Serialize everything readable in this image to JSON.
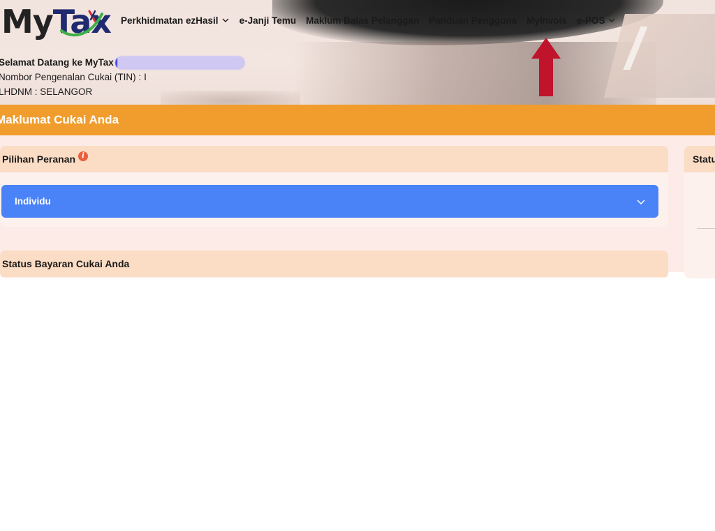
{
  "brand": {
    "logo_prefix": "My",
    "logo_suffix": "Tax"
  },
  "nav": {
    "items": [
      {
        "label": "Perkhidmatan ezHasil",
        "has_dropdown": true
      },
      {
        "label": "e-Janji Temu",
        "has_dropdown": false
      },
      {
        "label": "Maklum Balas Pelanggan",
        "has_dropdown": false
      },
      {
        "label": "Panduan Pengguna",
        "has_dropdown": false
      },
      {
        "label": "MyInvois",
        "has_dropdown": false
      },
      {
        "label": "e-POS",
        "has_dropdown": true
      }
    ]
  },
  "welcome": {
    "greeting": "Selamat Datang ke MyTax",
    "tin_label": "Nombor Pengenalan Cukai (TIN) :",
    "tin_value": "I",
    "lhdnm": "LHDNM : SELANGOR"
  },
  "section": {
    "title": "Maklumat Cukai Anda"
  },
  "role_card": {
    "title": "Pilihan Peranan",
    "info_icon": "info-icon",
    "selected_role": "Individu"
  },
  "payment_card": {
    "title": "Status Bayaran Cukai Anda"
  },
  "right_card": {
    "title": "Status"
  },
  "annotation": {
    "arrow_color": "#c0142d",
    "points_to": "MyInvois"
  },
  "colors": {
    "band": "#f09d2e",
    "card_header": "#fbdcc4",
    "select": "#4a82f7",
    "content_bg": "#fcebe6"
  }
}
